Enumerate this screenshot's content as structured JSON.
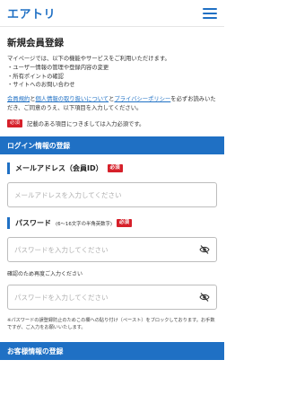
{
  "header": {
    "logo": "エアトリ"
  },
  "intro": {
    "title": "新規会員登録",
    "description": "マイページでは、以下の機能やサービスをご利用いただけます。",
    "bullets": [
      "・ユーザー情報の管理や登録内容の変更",
      "・所有ポイントの確認",
      "・サイトへのお問い合わせ"
    ],
    "agree_link1": "会員規約",
    "agree_and1": "と",
    "agree_link2": "個人情報の取り扱いについて",
    "agree_and2": "と",
    "agree_link3": "プライバシーポリシー",
    "agree_rest": "を必ずお読みいただき、ご同意のうえ、以下項目を入力してください。",
    "required_badge": "必須",
    "required_note": "記載のある項目につきましては入力必須です。"
  },
  "login_section": {
    "title": "ログイン情報の登録",
    "email_label": "メールアドレス（会員ID）",
    "email_badge": "必須",
    "email_placeholder": "メールアドレスを入力してください",
    "password_label": "パスワード",
    "password_hint": "(6〜16文字の半角英数字)",
    "password_badge": "必須",
    "password_placeholder": "パスワードを入力してください",
    "confirm_label": "確認のため再度ご入力ください",
    "confirm_placeholder": "パスワードを入力してください",
    "note": "※パスワードの誤登録防止のためこの欄への貼り付け（ペースト）をブロックしております。お手数ですが、ご入力をお願いいたします。"
  },
  "customer_section": {
    "title": "お客様情報の登録"
  },
  "icons": {
    "eye": "eye-off-icon",
    "menu": "hamburger-menu-icon"
  },
  "colors": {
    "brand": "#1f70c4",
    "required": "#d6202a"
  }
}
